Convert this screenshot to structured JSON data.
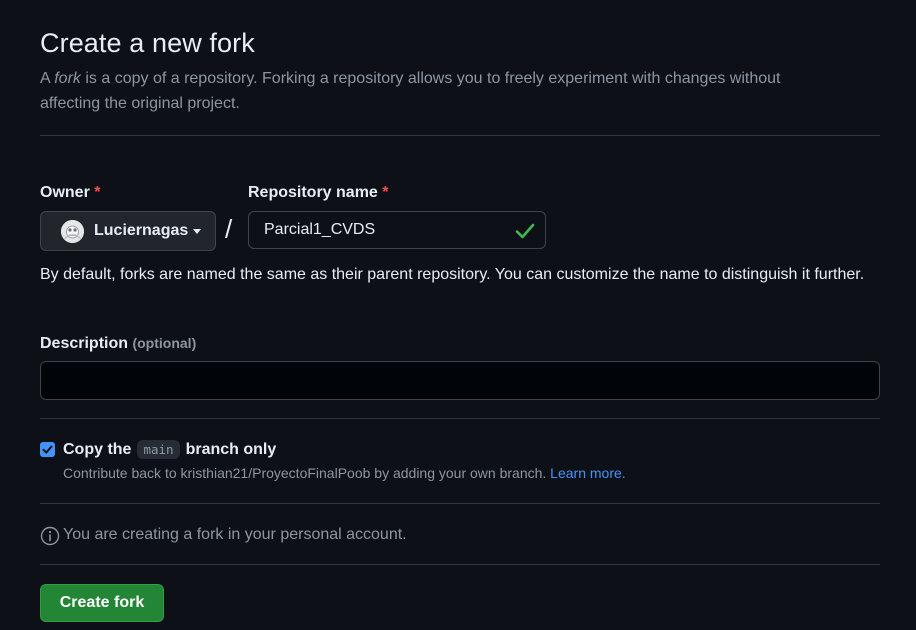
{
  "header": {
    "title": "Create a new fork",
    "subtitle_prefix": "A ",
    "subtitle_emphasis": "fork",
    "subtitle_line1": " is a copy of a repository. Forking a repository allows you to freely experiment with changes without",
    "subtitle_line2": "affecting the original project."
  },
  "owner": {
    "label": "Owner",
    "required_mark": "*",
    "value": "Luciernagas"
  },
  "separator": "/",
  "repo": {
    "label": "Repository name",
    "required_mark": "*",
    "value": "Parcial1_CVDS",
    "valid_icon": "check-icon",
    "valid_color": "#3fb950"
  },
  "name_hint": "By default, forks are named the same as their parent repository. You can customize the name to distinguish it further.",
  "description": {
    "label": "Description",
    "optional_text": "(optional)",
    "value": ""
  },
  "copy_branch": {
    "checked": true,
    "label_prefix": "Copy the",
    "branch": "main",
    "label_suffix": "branch only",
    "note_text": "Contribute back to kristhian21/ProyectoFinalPoob by adding your own branch.",
    "learn_more": "Learn more."
  },
  "account_notice": {
    "icon": "info-icon",
    "text": "You are creating a fork in your personal account."
  },
  "submit": {
    "label": "Create fork"
  },
  "colors": {
    "background": "#0d1117",
    "accent_green": "#238636",
    "link_blue": "#4493f8",
    "required_red": "#f85149"
  }
}
